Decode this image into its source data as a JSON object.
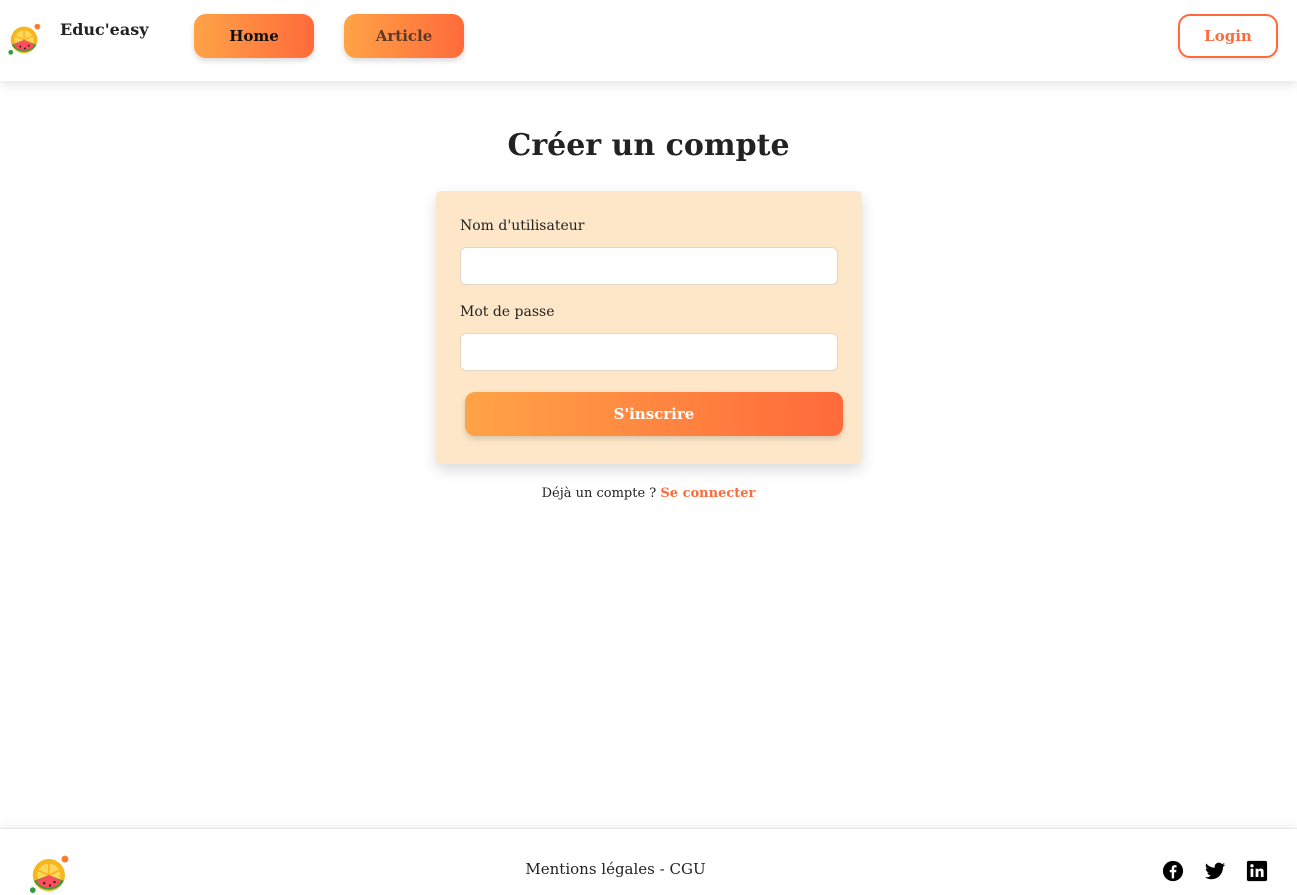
{
  "header": {
    "brand": "Educ'easy",
    "nav": {
      "home": "Home",
      "article": "Article"
    },
    "login": "Login"
  },
  "main": {
    "title": "Créer un compte",
    "form": {
      "username_label": "Nom d'utilisateur",
      "username_value": "",
      "password_label": "Mot de passe",
      "password_value": "",
      "submit": "S'inscrire"
    },
    "signin_prompt": "Déjà un compte ?",
    "signin_link": "Se connecter"
  },
  "footer": {
    "links": "Mentions légales - CGU",
    "social": [
      "facebook-icon",
      "twitter-icon",
      "linkedin-icon"
    ]
  },
  "colors": {
    "accent": "#ff6a3a",
    "accent_light": "#ffa347",
    "card_bg": "#fde7c8"
  }
}
